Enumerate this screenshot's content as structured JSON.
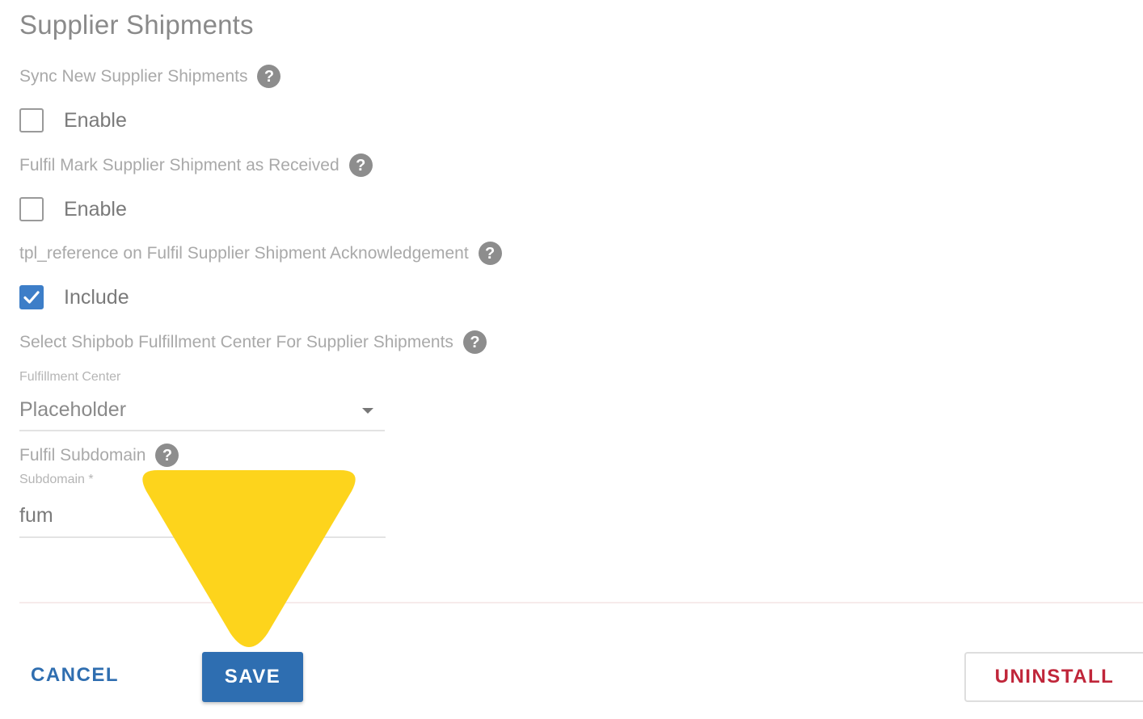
{
  "section": {
    "title": "Supplier Shipments"
  },
  "sync_new": {
    "label": "Sync New Supplier Shipments",
    "checkbox_label": "Enable",
    "checked": false
  },
  "mark_received": {
    "label": "Fulfil Mark Supplier Shipment as Received",
    "checkbox_label": "Enable",
    "checked": false
  },
  "tpl_reference": {
    "label": "tpl_reference on Fulfil Supplier Shipment Acknowledgement",
    "checkbox_label": "Include",
    "checked": true
  },
  "fulfillment_center": {
    "label": "Select Shipbob Fulfillment Center For Supplier Shipments",
    "field_label": "Fulfillment Center",
    "selected": "Placeholder"
  },
  "subdomain": {
    "label": "Fulfil Subdomain",
    "field_label": "Subdomain *",
    "value": "fum"
  },
  "actions": {
    "cancel_label": "CANCEL",
    "save_label": "SAVE",
    "uninstall_label": "UNINSTALL"
  },
  "help_glyph": "?",
  "icons": {
    "help": "question-circle-icon",
    "check": "checkmark-icon",
    "dropdown": "caret-down-icon",
    "annotation": "yellow-arrow-pointer"
  },
  "colors": {
    "primary": "#2e6eb1",
    "danger": "#c0263a",
    "checkbox_checked": "#3d7ec8",
    "annotation": "#fdd41c"
  }
}
